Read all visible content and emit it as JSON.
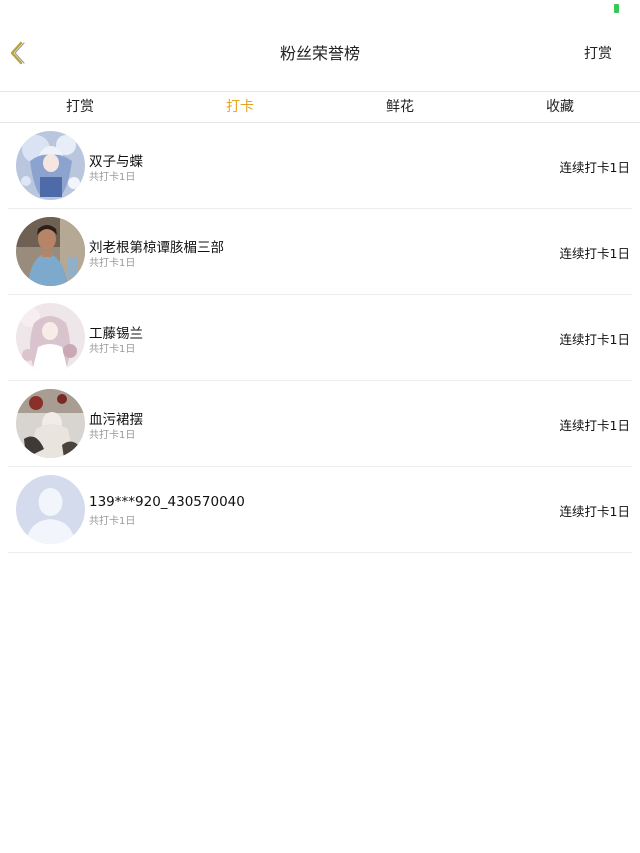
{
  "nav": {
    "title": "粉丝荣誉榜",
    "right_action": "打赏"
  },
  "tabs": [
    {
      "label": "打赏",
      "active": false
    },
    {
      "label": "打卡",
      "active": true
    },
    {
      "label": "鲜花",
      "active": false
    },
    {
      "label": "收藏",
      "active": false
    }
  ],
  "colors": {
    "accent": "#e6a423",
    "battery": "#34c759"
  },
  "fans": [
    {
      "name": "双子与蝶",
      "subtitle": "共打卡1日",
      "streak": "连续打卡1日",
      "avatar": "anime-girl-blue"
    },
    {
      "name": "刘老根第椋谭胲楣三部",
      "subtitle": "共打卡1日",
      "streak": "连续打卡1日",
      "avatar": "man-photo"
    },
    {
      "name": "工藤锡兰",
      "subtitle": "共打卡1日",
      "streak": "连续打卡1日",
      "avatar": "anime-girl-pink"
    },
    {
      "name": "血污裙摆",
      "subtitle": "共打卡1日",
      "streak": "连续打卡1日",
      "avatar": "anime-art-gray"
    },
    {
      "name": "139***920_430570040",
      "subtitle": "共打卡1日",
      "streak": "连续打卡1日",
      "avatar": "default-user"
    }
  ]
}
